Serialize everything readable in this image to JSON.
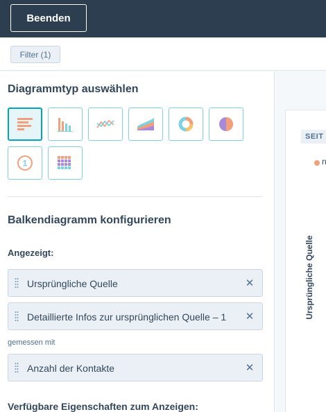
{
  "topbar": {
    "exit_label": "Beenden"
  },
  "filterbar": {
    "filter_label": "Filter (1)"
  },
  "chart_types": {
    "title": "Diagrammtyp auswählen",
    "items": [
      {
        "icon": "horizontal-bar-chart-icon",
        "selected": true
      },
      {
        "icon": "vertical-bar-chart-icon",
        "selected": false
      },
      {
        "icon": "line-chart-icon",
        "selected": false
      },
      {
        "icon": "area-chart-icon",
        "selected": false
      },
      {
        "icon": "donut-chart-icon",
        "selected": false
      },
      {
        "icon": "pie-chart-icon",
        "selected": false
      },
      {
        "icon": "summary-number-icon",
        "selected": false,
        "text": "1"
      },
      {
        "icon": "table-chart-icon",
        "selected": false
      }
    ]
  },
  "configure": {
    "title": "Balkendiagramm konfigurieren",
    "displayed_label": "Angezeigt:",
    "displayed_items": [
      "Ursprüngliche Quelle",
      "Detaillierte Infos zur ursprünglichen Quelle – 1"
    ],
    "measured_with_label": "gemessen mit",
    "measure_items": [
      "Anzahl der Kontakte"
    ],
    "available_label": "Verfügbare Eigenschaften zum Anzeigen:"
  },
  "preview": {
    "tag_label": "SEIT",
    "legend_text": "n",
    "y_axis_label": "Ursprüngliche Quelle"
  },
  "colors": {
    "topbar": "#2d3e50",
    "accent": "#00a4bd",
    "chart_orange": "#f2a07b",
    "chart_teal": "#7fd1de"
  }
}
